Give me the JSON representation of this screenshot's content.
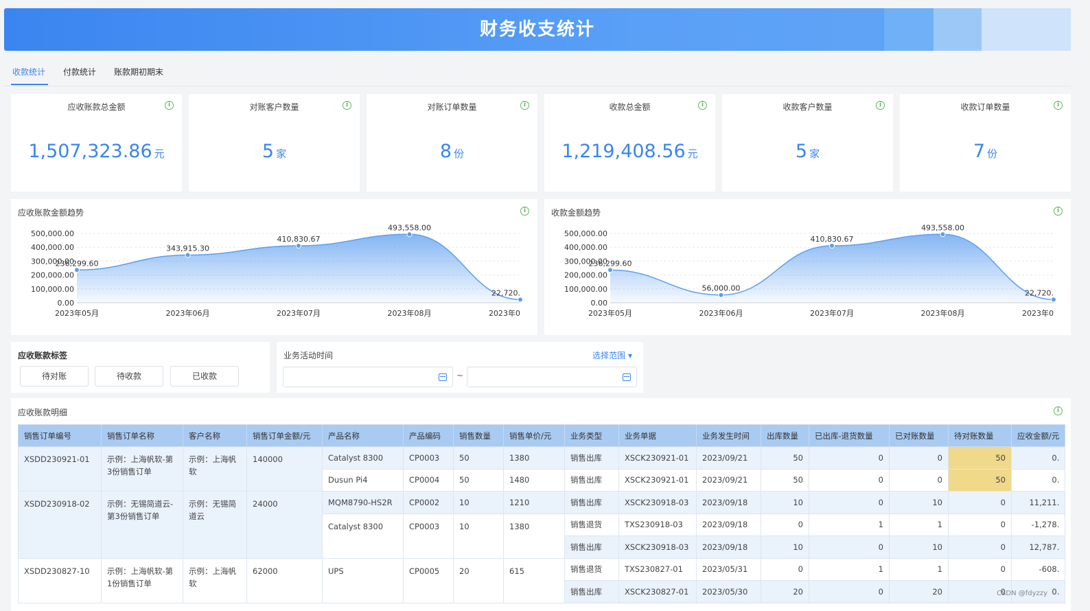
{
  "header": {
    "title": "财务收支统计"
  },
  "tabs": [
    {
      "label": "收款统计",
      "active": true
    },
    {
      "label": "付款统计",
      "active": false
    },
    {
      "label": "账款期初期末",
      "active": false
    }
  ],
  "stats": [
    {
      "label": "应收账款总金额",
      "value": "1,507,323.86",
      "unit": "元"
    },
    {
      "label": "对账客户数量",
      "value": "5",
      "unit": "家"
    },
    {
      "label": "对账订单数量",
      "value": "8",
      "unit": "份"
    },
    {
      "label": "收款总金额",
      "value": "1,219,408.56",
      "unit": "元"
    },
    {
      "label": "收款客户数量",
      "value": "5",
      "unit": "家"
    },
    {
      "label": "收款订单数量",
      "value": "7",
      "unit": "份"
    }
  ],
  "chart_data": [
    {
      "type": "area",
      "title": "应收账款金额趋势",
      "categories": [
        "2023年05月",
        "2023年06月",
        "2023年07月",
        "2023年08月",
        "2023年0"
      ],
      "values": [
        236299.6,
        343915.3,
        410830.67,
        493558.0,
        22720
      ],
      "value_labels": [
        "236,299.60",
        "343,915.30",
        "410,830.67",
        "493,558.00",
        "22,720."
      ],
      "yticks": [
        "0.00",
        "100,000.00",
        "200,000.00",
        "300,000.00",
        "400,000.00",
        "500,000.00"
      ],
      "ylim": [
        0,
        500000
      ],
      "grid": true,
      "color": "#5b9ef0"
    },
    {
      "type": "area",
      "title": "收款金额趋势",
      "categories": [
        "2023年05月",
        "2023年06月",
        "2023年07月",
        "2023年08月",
        "2023年0"
      ],
      "values": [
        236299.6,
        56000.0,
        410830.67,
        493558.0,
        22720
      ],
      "value_labels": [
        "236,299.60",
        "56,000.00",
        "410,830.67",
        "493,558.00",
        "22,720."
      ],
      "yticks": [
        "0.00",
        "100,000.00",
        "200,000.00",
        "300,000.00",
        "400,000.00",
        "500,000.00"
      ],
      "ylim": [
        0,
        500000
      ],
      "grid": true,
      "color": "#5b9ef0"
    }
  ],
  "filters": {
    "tags_title": "应收账款标签",
    "tags": [
      "待对账",
      "待收款",
      "已收款"
    ],
    "time_title": "业务活动时间",
    "range_label": "选择范围",
    "range_sep": "~"
  },
  "detail": {
    "title": "应收账款明细",
    "columns": [
      "销售订单编号",
      "销售订单名称",
      "客户名称",
      "销售订单金额/元",
      "产品名称",
      "产品编码",
      "销售数量",
      "销售单价/元",
      "业务类型",
      "业务单据",
      "业务发生时间",
      "出库数量",
      "已出库-退货数量",
      "已对账数量",
      "待对账数量",
      "应收金额/元"
    ],
    "rows": [
      {
        "order_no": "XSDD230921-01",
        "order_name": "示例：上海帆软-第3份销售订单",
        "customer": "示例：上海帆软",
        "amount": "140000",
        "product": "Catalyst 8300",
        "code": "CP0003",
        "qty": "50",
        "price": "1380",
        "type": "销售出库",
        "doc": "XSCK230921-01",
        "date": "2023/09/21",
        "out": "50",
        "net": "0",
        "reconciled": "0",
        "pending": "50",
        "receivable": "0."
      },
      {
        "product": "Dusun Pi4",
        "code": "CP0004",
        "qty": "50",
        "price": "1480",
        "type": "销售出库",
        "doc": "XSCK230921-01",
        "date": "2023/09/21",
        "out": "50",
        "net": "0",
        "reconciled": "0",
        "pending": "50",
        "receivable": "0."
      },
      {
        "order_no": "XSDD230918-02",
        "order_name": "示例：无锡简道云-第3份销售订单",
        "customer": "示例：无锡简道云",
        "amount": "24000",
        "product": "MQM8790-HS2R",
        "code": "CP0002",
        "qty": "10",
        "price": "1210",
        "type": "销售出库",
        "doc": "XSCK230918-03",
        "date": "2023/09/18",
        "out": "10",
        "net": "0",
        "reconciled": "10",
        "pending": "0",
        "receivable": "11,211."
      },
      {
        "product": "Catalyst 8300",
        "code": "CP0003",
        "qty": "10",
        "price": "1380",
        "type": "销售退货",
        "doc": "TXS230918-03",
        "date": "2023/09/18",
        "out": "0",
        "net": "1",
        "reconciled": "1",
        "pending": "0",
        "receivable": "-1,278."
      },
      {
        "type": "销售出库",
        "doc": "XSCK230918-03",
        "date": "2023/09/18",
        "out": "10",
        "net": "0",
        "reconciled": "10",
        "pending": "0",
        "receivable": "12,787."
      },
      {
        "order_no": "XSDD230827-10",
        "order_name": "示例：上海帆软-第1份销售订单",
        "customer": "示例：上海帆软",
        "amount": "62000",
        "product": "UPS",
        "code": "CP0005",
        "qty": "20",
        "price": "615",
        "type": "销售退货",
        "doc": "TXS230827-01",
        "date": "2023/05/31",
        "out": "0",
        "net": "1",
        "reconciled": "1",
        "pending": "0",
        "receivable": "-608."
      },
      {
        "type": "销售出库",
        "doc": "XSCK230827-01",
        "date": "2023/05/30",
        "out": "20",
        "net": "0",
        "reconciled": "20",
        "pending": "0",
        "receivable": "0."
      }
    ]
  },
  "watermark": "CSDN @fdyzzy"
}
